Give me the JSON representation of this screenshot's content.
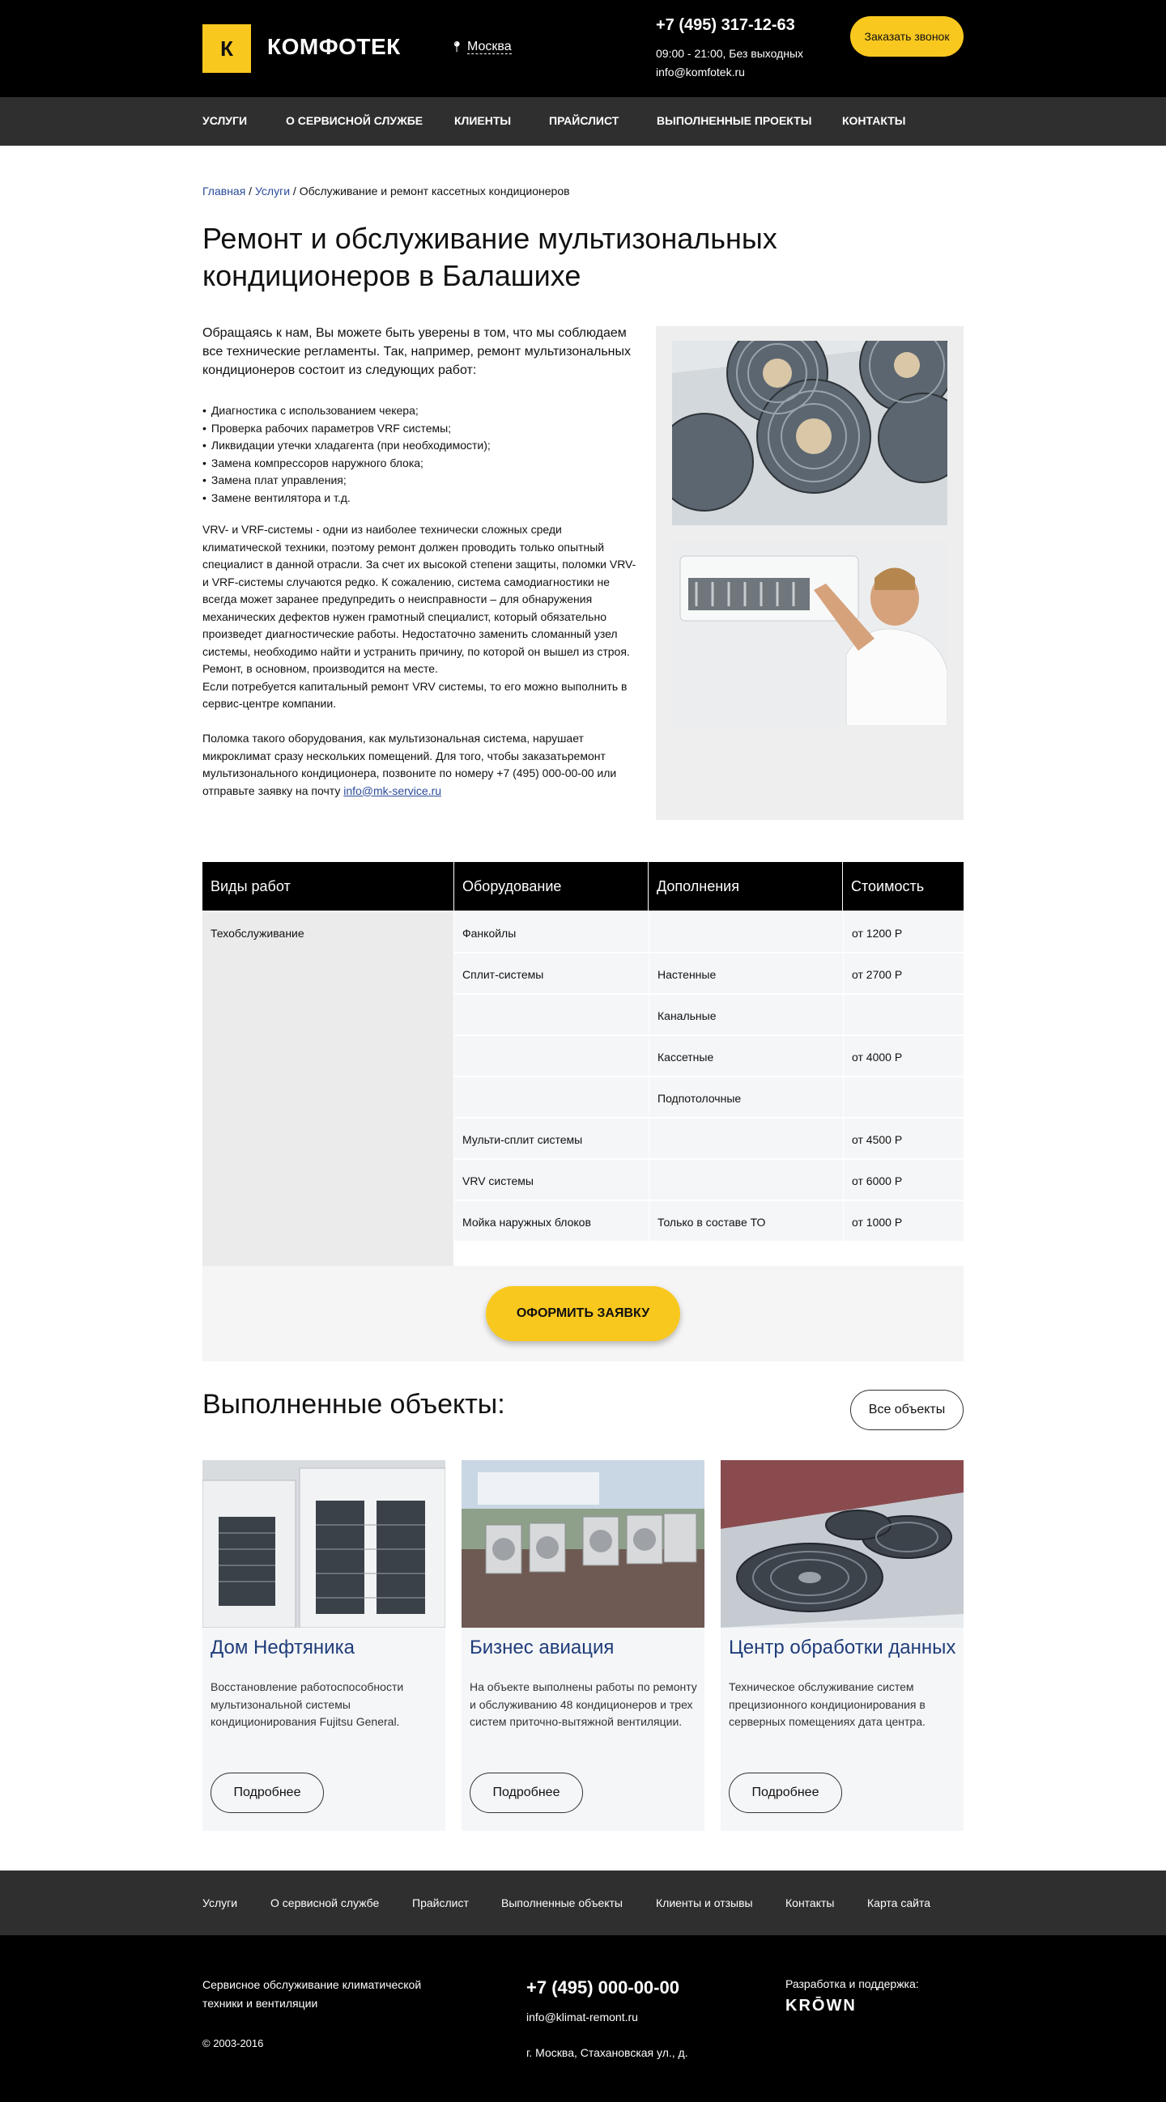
{
  "header": {
    "logo_letter": "К",
    "logo_text": "КОМФОТЕК",
    "city": "Москва",
    "phone": "+7 (495) 317-12-63",
    "hours": "09:00 - 21:00, Без выходных",
    "email": "info@komfotek.ru",
    "call_button": "Заказать звонок"
  },
  "nav": [
    "Услуги",
    "О сервисной службе",
    "Клиенты",
    "Прайслист",
    "Выполненные проекты",
    "Контакты"
  ],
  "breadcrumbs": {
    "home": "Главная",
    "services": "Услуги",
    "current": "Обслуживание и ремонт кассетных кондиционеров"
  },
  "title": "Ремонт и обслуживание мультизональных кондиционеров в Балашихе",
  "intro": "Обращаясь к нам, Вы можете быть уверены в том, что мы соблюдаем все технические регламенты. Так, например, ремонт мультизональных кондиционеров состоит из следующих работ:",
  "works_list": [
    "Диагностика с использованием чекера;",
    "Проверка рабочих параметров VRF системы;",
    "Ликвидации утечки хладагента (при необходимости);",
    "Замена компрессоров наружного блока;",
    "Замена плат управления;",
    "Замене вентилятора и т.д."
  ],
  "body_text_1": "VRV- и VRF-системы - одни из наиболее технически сложных среди климатической техники, поэтому ремонт должен проводить только опытный специалист в данной отрасли. За счет их высокой степени защиты, поломки VRV- и VRF-системы случаются редко. К сожалению, система самодиагностики не всегда может заранее предупредить о неисправности – для обнаружения механических дефектов нужен грамотный специалист, который обязательно произведет диагностические работы. Недостаточно заменить сломанный узел системы, необходимо найти и устранить причину, по которой он вышел из строя. Ремонт, в основном, производится на месте.",
  "body_text_1b": "Если потребуется капитальный ремонт VRV системы, то его можно выполнить в сервис-центре компании.",
  "body_text_2": "Поломка такого оборудования, как мультизональная система, нарушает микроклимат сразу нескольких помещений. Для того, чтобы заказатьремонт мультизонального кондиционера, позвоните по номеру +7 (495) 000-00-00 или отправьте заявку на почту ",
  "body_link": "info@mk-service.ru",
  "price_table": {
    "headers": [
      "Виды работ",
      "Оборудование",
      "Дополнения",
      "Стоимость"
    ],
    "work_type": "Техобслуживание",
    "rows": [
      {
        "equipment": "Фанкойлы",
        "extra": "",
        "price": "от 1200 Р"
      },
      {
        "equipment": "Сплит-системы",
        "extra": "Настенные",
        "price": "от 2700 Р"
      },
      {
        "equipment": "",
        "extra": "Канальные",
        "price": ""
      },
      {
        "equipment": "",
        "extra": "Кассетные",
        "price": "от 4000 Р"
      },
      {
        "equipment": "",
        "extra": "Подпотолочные",
        "price": ""
      },
      {
        "equipment": "Мульти-сплит системы",
        "extra": "",
        "price": "от 4500 Р"
      },
      {
        "equipment": "VRV системы",
        "extra": "",
        "price": "от 6000 Р"
      },
      {
        "equipment": "Мойка наружных блоков",
        "extra": "Только в составе ТО",
        "price": "от 1000 Р"
      }
    ]
  },
  "order_button": "Оформить заявку",
  "objects": {
    "title": "Выполненные объекты:",
    "all_button": "Все объекты",
    "more_label": "Подробнее",
    "cards": [
      {
        "title": "Дом Нефтяника",
        "desc": "Восстановление работоспособности мультизональной системы кондиционирования Fujitsu General."
      },
      {
        "title": "Бизнес авиация",
        "desc": "На объекте выполнены работы по ремонту и обслуживанию 48 кондиционеров и трех систем приточно-вытяжной вентиляции."
      },
      {
        "title": "Центр обработки данных",
        "desc": "Техническое обслуживание систем прецизионного кондиционирования в серверных помещениях дата центра."
      }
    ]
  },
  "footer_nav": [
    "Услуги",
    "О сервисной службе",
    "Прайслист",
    "Выполненные объекты",
    "Клиенты и отзывы",
    "Контакты",
    "Карта сайта"
  ],
  "footer": {
    "desc": "Сервисное обслуживание климатической техники и вентиляции",
    "copyright": "© 2003-2016",
    "phone": "+7 (495) 000-00-00",
    "email": "info@klimat-remont.ru",
    "address": "г. Москва, Стахановская ул., д.",
    "dev_label": "Разработка и поддержка:",
    "dev_name": "KRŌWN"
  },
  "colors": {
    "accent": "#f9c81f",
    "header_bg": "#000000",
    "nav_bg": "#2f2f2f",
    "link": "#2a4a9a",
    "card_title": "#1f3d7a"
  }
}
